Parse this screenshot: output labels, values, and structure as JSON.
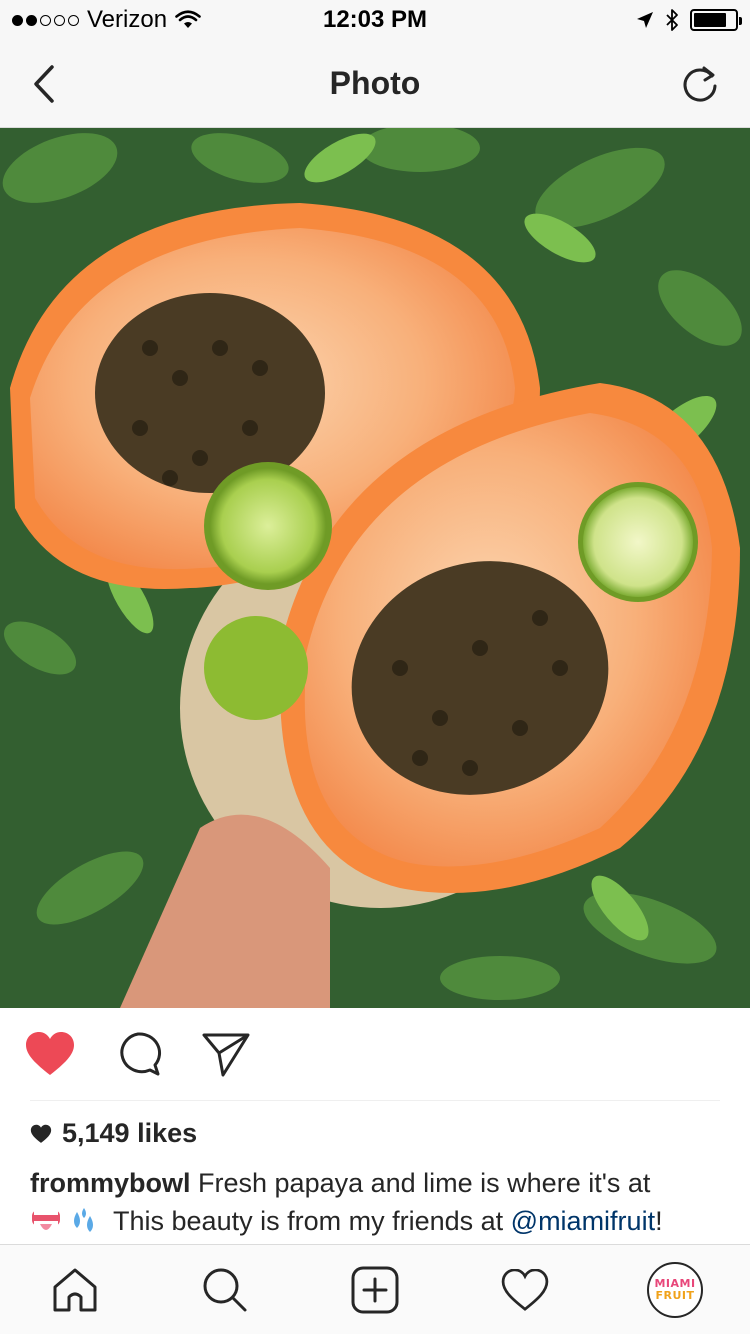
{
  "status_bar": {
    "carrier": "Verizon",
    "time": "12:03 PM",
    "battery_level": 0.8
  },
  "nav": {
    "title": "Photo"
  },
  "post": {
    "likes": "5,149 likes",
    "caption_user": "frommybowl",
    "caption_text": " Fresh papaya and lime is where it's at",
    "caption_line2": " This beauty is from my friends at ",
    "mention": "@miamifruit",
    "mention_suffix": "!",
    "liked": true
  },
  "profile": {
    "avatar_line1": "MIAMI",
    "avatar_line2": "FRUIT"
  },
  "colors": {
    "like_red": "#ed4956",
    "mention_blue": "#003569",
    "papaya_orange": "#f79a5a"
  },
  "icons": {
    "back": "chevron-left-icon",
    "refresh": "refresh-icon",
    "like": "heart-filled-icon",
    "comment": "comment-icon",
    "share": "share-icon",
    "home": "home-icon",
    "search": "search-icon",
    "add": "add-icon",
    "activity": "heart-outline-icon"
  }
}
